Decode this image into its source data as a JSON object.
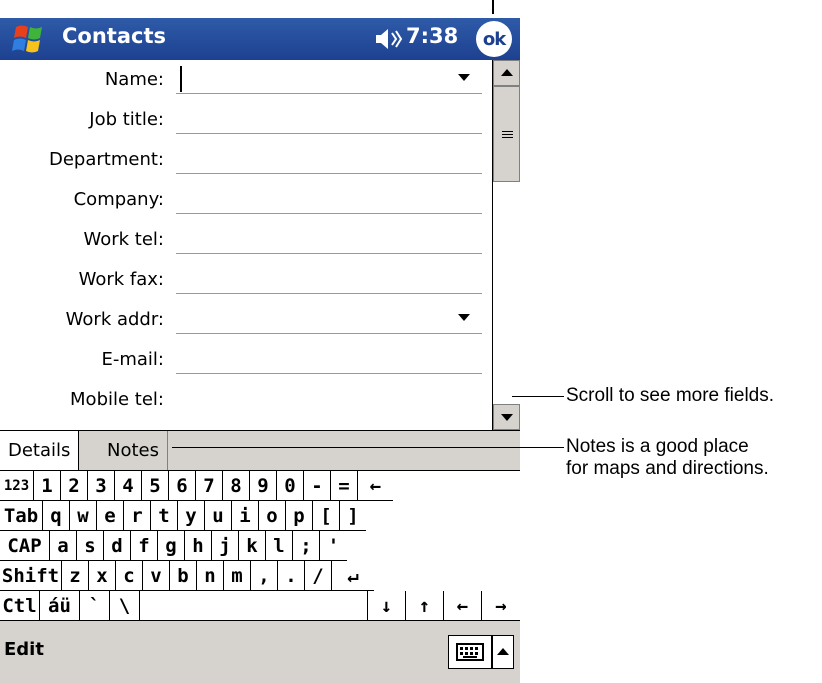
{
  "titlebar": {
    "app_title": "Contacts",
    "clock": "7:38",
    "ok_label": "ok"
  },
  "form": {
    "fields": [
      {
        "label": "Name:",
        "value": "",
        "has_dropdown": true
      },
      {
        "label": "Job title:",
        "value": ""
      },
      {
        "label": "Department:",
        "value": ""
      },
      {
        "label": "Company:",
        "value": ""
      },
      {
        "label": "Work tel:",
        "value": ""
      },
      {
        "label": "Work fax:",
        "value": ""
      },
      {
        "label": "Work addr:",
        "value": "",
        "has_dropdown": true
      },
      {
        "label": "E-mail:",
        "value": ""
      },
      {
        "label": "Mobile tel:",
        "value": ""
      }
    ]
  },
  "tabs": [
    {
      "label": "Details",
      "active": true
    },
    {
      "label": "Notes",
      "active": false
    }
  ],
  "keyboard": {
    "rows": [
      [
        "123",
        "1",
        "2",
        "3",
        "4",
        "5",
        "6",
        "7",
        "8",
        "9",
        "0",
        "-",
        "=",
        "←"
      ],
      [
        "Tab",
        "q",
        "w",
        "e",
        "r",
        "t",
        "y",
        "u",
        "i",
        "o",
        "p",
        "[",
        "]"
      ],
      [
        "CAP",
        "a",
        "s",
        "d",
        "f",
        "g",
        "h",
        "j",
        "k",
        "l",
        ";",
        "'"
      ],
      [
        "Shift",
        "z",
        "x",
        "c",
        "v",
        "b",
        "n",
        "m",
        ",",
        ".",
        "/",
        "↵"
      ],
      [
        "Ctl",
        "áü",
        "`",
        "\\",
        " ",
        "↓",
        "↑",
        "←",
        "→"
      ]
    ]
  },
  "menubar": {
    "edit_label": "Edit"
  },
  "callouts": {
    "scroll": "Scroll to see more fields.",
    "notes_line1": "Notes is a good place",
    "notes_line2": "for maps and directions."
  },
  "colors": {
    "title_blue": "#1d4190",
    "chrome_gray": "#d6d3ce"
  }
}
